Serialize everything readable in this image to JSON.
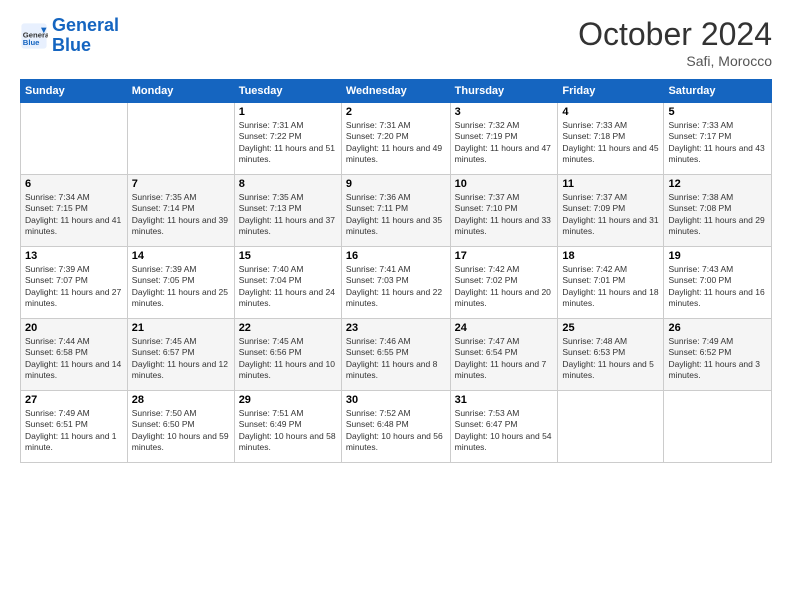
{
  "header": {
    "logo_line1": "General",
    "logo_line2": "Blue",
    "month": "October 2024",
    "location": "Safi, Morocco"
  },
  "days_of_week": [
    "Sunday",
    "Monday",
    "Tuesday",
    "Wednesday",
    "Thursday",
    "Friday",
    "Saturday"
  ],
  "weeks": [
    [
      {
        "day": "",
        "info": ""
      },
      {
        "day": "",
        "info": ""
      },
      {
        "day": "1",
        "info": "Sunrise: 7:31 AM\nSunset: 7:22 PM\nDaylight: 11 hours and 51 minutes."
      },
      {
        "day": "2",
        "info": "Sunrise: 7:31 AM\nSunset: 7:20 PM\nDaylight: 11 hours and 49 minutes."
      },
      {
        "day": "3",
        "info": "Sunrise: 7:32 AM\nSunset: 7:19 PM\nDaylight: 11 hours and 47 minutes."
      },
      {
        "day": "4",
        "info": "Sunrise: 7:33 AM\nSunset: 7:18 PM\nDaylight: 11 hours and 45 minutes."
      },
      {
        "day": "5",
        "info": "Sunrise: 7:33 AM\nSunset: 7:17 PM\nDaylight: 11 hours and 43 minutes."
      }
    ],
    [
      {
        "day": "6",
        "info": "Sunrise: 7:34 AM\nSunset: 7:15 PM\nDaylight: 11 hours and 41 minutes."
      },
      {
        "day": "7",
        "info": "Sunrise: 7:35 AM\nSunset: 7:14 PM\nDaylight: 11 hours and 39 minutes."
      },
      {
        "day": "8",
        "info": "Sunrise: 7:35 AM\nSunset: 7:13 PM\nDaylight: 11 hours and 37 minutes."
      },
      {
        "day": "9",
        "info": "Sunrise: 7:36 AM\nSunset: 7:11 PM\nDaylight: 11 hours and 35 minutes."
      },
      {
        "day": "10",
        "info": "Sunrise: 7:37 AM\nSunset: 7:10 PM\nDaylight: 11 hours and 33 minutes."
      },
      {
        "day": "11",
        "info": "Sunrise: 7:37 AM\nSunset: 7:09 PM\nDaylight: 11 hours and 31 minutes."
      },
      {
        "day": "12",
        "info": "Sunrise: 7:38 AM\nSunset: 7:08 PM\nDaylight: 11 hours and 29 minutes."
      }
    ],
    [
      {
        "day": "13",
        "info": "Sunrise: 7:39 AM\nSunset: 7:07 PM\nDaylight: 11 hours and 27 minutes."
      },
      {
        "day": "14",
        "info": "Sunrise: 7:39 AM\nSunset: 7:05 PM\nDaylight: 11 hours and 25 minutes."
      },
      {
        "day": "15",
        "info": "Sunrise: 7:40 AM\nSunset: 7:04 PM\nDaylight: 11 hours and 24 minutes."
      },
      {
        "day": "16",
        "info": "Sunrise: 7:41 AM\nSunset: 7:03 PM\nDaylight: 11 hours and 22 minutes."
      },
      {
        "day": "17",
        "info": "Sunrise: 7:42 AM\nSunset: 7:02 PM\nDaylight: 11 hours and 20 minutes."
      },
      {
        "day": "18",
        "info": "Sunrise: 7:42 AM\nSunset: 7:01 PM\nDaylight: 11 hours and 18 minutes."
      },
      {
        "day": "19",
        "info": "Sunrise: 7:43 AM\nSunset: 7:00 PM\nDaylight: 11 hours and 16 minutes."
      }
    ],
    [
      {
        "day": "20",
        "info": "Sunrise: 7:44 AM\nSunset: 6:58 PM\nDaylight: 11 hours and 14 minutes."
      },
      {
        "day": "21",
        "info": "Sunrise: 7:45 AM\nSunset: 6:57 PM\nDaylight: 11 hours and 12 minutes."
      },
      {
        "day": "22",
        "info": "Sunrise: 7:45 AM\nSunset: 6:56 PM\nDaylight: 11 hours and 10 minutes."
      },
      {
        "day": "23",
        "info": "Sunrise: 7:46 AM\nSunset: 6:55 PM\nDaylight: 11 hours and 8 minutes."
      },
      {
        "day": "24",
        "info": "Sunrise: 7:47 AM\nSunset: 6:54 PM\nDaylight: 11 hours and 7 minutes."
      },
      {
        "day": "25",
        "info": "Sunrise: 7:48 AM\nSunset: 6:53 PM\nDaylight: 11 hours and 5 minutes."
      },
      {
        "day": "26",
        "info": "Sunrise: 7:49 AM\nSunset: 6:52 PM\nDaylight: 11 hours and 3 minutes."
      }
    ],
    [
      {
        "day": "27",
        "info": "Sunrise: 7:49 AM\nSunset: 6:51 PM\nDaylight: 11 hours and 1 minute."
      },
      {
        "day": "28",
        "info": "Sunrise: 7:50 AM\nSunset: 6:50 PM\nDaylight: 10 hours and 59 minutes."
      },
      {
        "day": "29",
        "info": "Sunrise: 7:51 AM\nSunset: 6:49 PM\nDaylight: 10 hours and 58 minutes."
      },
      {
        "day": "30",
        "info": "Sunrise: 7:52 AM\nSunset: 6:48 PM\nDaylight: 10 hours and 56 minutes."
      },
      {
        "day": "31",
        "info": "Sunrise: 7:53 AM\nSunset: 6:47 PM\nDaylight: 10 hours and 54 minutes."
      },
      {
        "day": "",
        "info": ""
      },
      {
        "day": "",
        "info": ""
      }
    ]
  ]
}
